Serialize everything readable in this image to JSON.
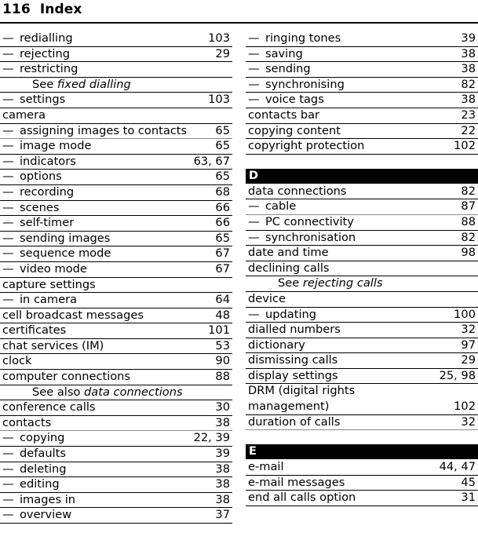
{
  "header": {
    "page_number": "116",
    "title": "Index",
    "combined": "116  Index"
  },
  "columns": [
    {
      "name": "left-column",
      "blocks": [
        {
          "type": "entries",
          "rows": [
            {
              "kind": "sub",
              "dash": "—",
              "text": "redialling",
              "page": "103",
              "rule": "thin"
            },
            {
              "kind": "sub",
              "dash": "—",
              "text": "rejecting",
              "page": "29",
              "rule": "thin"
            },
            {
              "kind": "sub",
              "dash": "—",
              "text": "restricting",
              "page": "",
              "rule": "thin"
            },
            {
              "kind": "see",
              "see_label": "See",
              "see_target": "fixed dialling",
              "rule": "thin"
            },
            {
              "kind": "sub",
              "dash": "—",
              "text": "settings",
              "page": "103",
              "rule": "thin"
            },
            {
              "kind": "top",
              "dash": "",
              "text": "camera",
              "page": "",
              "rule": "thin"
            },
            {
              "kind": "sub",
              "dash": "—",
              "text": "assigning images to contacts",
              "page": "65",
              "rule": "thick"
            },
            {
              "kind": "sub",
              "dash": "—",
              "text": "image mode",
              "page": "65",
              "rule": "thin"
            },
            {
              "kind": "sub",
              "dash": "—",
              "text": "indicators",
              "page": "63, 67",
              "rule": "thin"
            },
            {
              "kind": "sub",
              "dash": "—",
              "text": "options",
              "page": "65",
              "rule": "thin"
            },
            {
              "kind": "sub",
              "dash": "—",
              "text": "recording",
              "page": "68",
              "rule": "thin"
            },
            {
              "kind": "sub",
              "dash": "—",
              "text": "scenes",
              "page": "66",
              "rule": "thin"
            },
            {
              "kind": "sub",
              "dash": "—",
              "text": "self-timer",
              "page": "66",
              "rule": "thin"
            },
            {
              "kind": "sub",
              "dash": "—",
              "text": "sending images",
              "page": "65",
              "rule": "thin"
            },
            {
              "kind": "sub",
              "dash": "—",
              "text": "sequence mode",
              "page": "67",
              "rule": "thin"
            },
            {
              "kind": "sub",
              "dash": "—",
              "text": "video mode",
              "page": "67",
              "rule": "thin"
            },
            {
              "kind": "top",
              "dash": "",
              "text": "capture settings",
              "page": "",
              "rule": "thin"
            },
            {
              "kind": "sub",
              "dash": "—",
              "text": "in camera",
              "page": "64",
              "rule": "thin"
            },
            {
              "kind": "top",
              "dash": "",
              "text": "cell broadcast messages",
              "page": "48",
              "rule": "thin"
            },
            {
              "kind": "top",
              "dash": "",
              "text": "certificates",
              "page": "101",
              "rule": "thin"
            },
            {
              "kind": "top",
              "dash": "",
              "text": "chat services (IM)",
              "page": "53",
              "rule": "thin"
            },
            {
              "kind": "top",
              "dash": "",
              "text": "clock",
              "page": "90",
              "rule": "thin"
            },
            {
              "kind": "top",
              "dash": "",
              "text": "computer connections",
              "page": "88",
              "rule": "thin"
            },
            {
              "kind": "see",
              "see_label": "See also",
              "see_target": "data connections",
              "rule": "thin"
            },
            {
              "kind": "top",
              "dash": "",
              "text": "conference calls",
              "page": "30",
              "rule": "thin"
            },
            {
              "kind": "top",
              "dash": "",
              "text": "contacts",
              "page": "38",
              "rule": "thick"
            },
            {
              "kind": "sub",
              "dash": "—",
              "text": "copying",
              "page": "22, 39",
              "rule": "thin"
            },
            {
              "kind": "sub",
              "dash": "—",
              "text": "defaults",
              "page": "39",
              "rule": "thin"
            },
            {
              "kind": "sub",
              "dash": "—",
              "text": "deleting",
              "page": "38",
              "rule": "thin"
            },
            {
              "kind": "sub",
              "dash": "—",
              "text": "editing",
              "page": "38",
              "rule": "thin"
            },
            {
              "kind": "sub",
              "dash": "—",
              "text": "images in",
              "page": "38",
              "rule": "thin"
            },
            {
              "kind": "sub",
              "dash": "—",
              "text": "overview",
              "page": "37",
              "rule": "thin"
            }
          ]
        }
      ]
    },
    {
      "name": "right-column",
      "blocks": [
        {
          "type": "entries",
          "rows": [
            {
              "kind": "sub",
              "dash": "—",
              "text": "ringing tones",
              "page": "39",
              "rule": "thin"
            },
            {
              "kind": "sub",
              "dash": "—",
              "text": "saving",
              "page": "38",
              "rule": "thin"
            },
            {
              "kind": "sub",
              "dash": "—",
              "text": "sending",
              "page": "38",
              "rule": "thin"
            },
            {
              "kind": "sub",
              "dash": "—",
              "text": "synchronising",
              "page": "82",
              "rule": "thin"
            },
            {
              "kind": "sub",
              "dash": "—",
              "text": "voice tags",
              "page": "38",
              "rule": "thin"
            },
            {
              "kind": "top",
              "dash": "",
              "text": "contacts bar",
              "page": "23",
              "rule": "thin"
            },
            {
              "kind": "top",
              "dash": "",
              "text": "copying content",
              "page": "22",
              "rule": "thin"
            },
            {
              "kind": "top",
              "dash": "",
              "text": "copyright protection",
              "page": "102",
              "rule": "thin"
            }
          ]
        },
        {
          "type": "section",
          "letter": "D"
        },
        {
          "type": "entries",
          "rows": [
            {
              "kind": "top",
              "dash": "",
              "text": "data connections",
              "page": "82",
              "rule": "thin"
            },
            {
              "kind": "sub",
              "dash": "—",
              "text": "cable",
              "page": "87",
              "rule": "thick"
            },
            {
              "kind": "sub",
              "dash": "—",
              "text": "PC connectivity",
              "page": "88",
              "rule": "thin"
            },
            {
              "kind": "sub",
              "dash": "—",
              "text": "synchronisation",
              "page": "82",
              "rule": "thin"
            },
            {
              "kind": "top",
              "dash": "",
              "text": "date and time",
              "page": "98",
              "rule": "thin"
            },
            {
              "kind": "top",
              "dash": "",
              "text": "declining calls",
              "page": "",
              "rule": "thin"
            },
            {
              "kind": "see",
              "see_label": "See",
              "see_target": "rejecting calls",
              "rule": "thin"
            },
            {
              "kind": "top",
              "dash": "",
              "text": "device",
              "page": "",
              "rule": "thin"
            },
            {
              "kind": "sub",
              "dash": "—",
              "text": "updating",
              "page": "100",
              "rule": "thin"
            },
            {
              "kind": "top",
              "dash": "",
              "text": "dialled numbers",
              "page": "32",
              "rule": "thin"
            },
            {
              "kind": "top",
              "dash": "",
              "text": "dictionary",
              "page": "97",
              "rule": "thin"
            },
            {
              "kind": "top",
              "dash": "",
              "text": "dismissing calls",
              "page": "29",
              "rule": "thin"
            },
            {
              "kind": "top",
              "dash": "",
              "text": "display settings",
              "page": "25, 98",
              "rule": "thin"
            },
            {
              "kind": "top",
              "dash": "",
              "text": "DRM (digital rights",
              "page": "",
              "rule": "none"
            },
            {
              "kind": "top",
              "dash": "",
              "text": "management)",
              "page": "102",
              "rule": "thin"
            },
            {
              "kind": "top",
              "dash": "",
              "text": "duration of calls",
              "page": "32",
              "rule": "thick"
            }
          ]
        },
        {
          "type": "section",
          "letter": "E"
        },
        {
          "type": "entries",
          "rows": [
            {
              "kind": "top",
              "dash": "",
              "text": "e-mail",
              "page": "44, 47",
              "rule": "thin"
            },
            {
              "kind": "top",
              "dash": "",
              "text": "e-mail messages",
              "page": "45",
              "rule": "thin"
            },
            {
              "kind": "top",
              "dash": "",
              "text": "end all calls option",
              "page": "31",
              "rule": "thin"
            }
          ]
        }
      ]
    }
  ],
  "colors": {
    "text": "#000000",
    "background": "#ffffff",
    "section_bar_bg": "#000000",
    "section_bar_text": "#ffffff",
    "rule_thin": "#000000",
    "rule_thick": "#8a8a8a"
  }
}
